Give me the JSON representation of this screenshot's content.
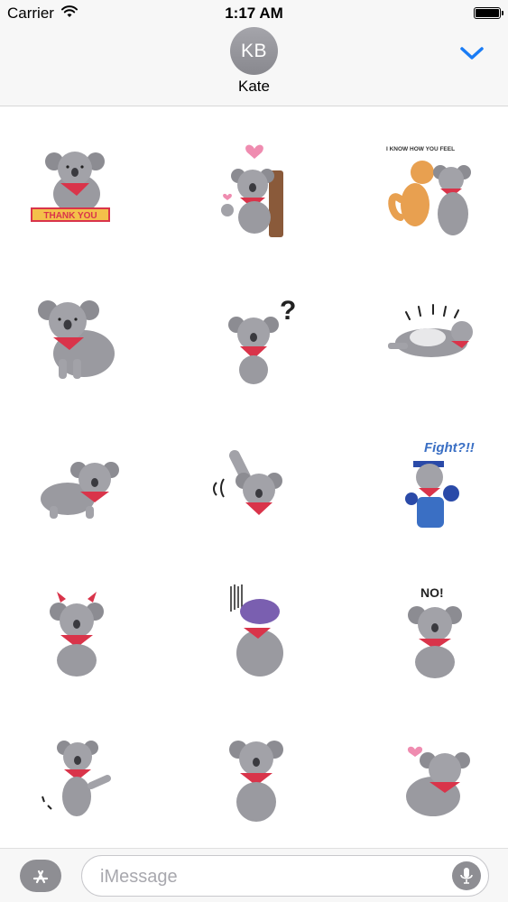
{
  "status_bar": {
    "carrier": "Carrier",
    "time": "1:17 AM",
    "battery_level": 1.0
  },
  "header": {
    "avatar_initials": "KB",
    "contact_name": "Kate",
    "collapse_icon": "chevron-down-icon",
    "accent_color": "#1a7cf5"
  },
  "stickers": [
    {
      "name": "koala-thank-you",
      "caption": "THANK YOU"
    },
    {
      "name": "koala-heart-tree",
      "caption": ""
    },
    {
      "name": "koala-friends",
      "caption": "I KNOW HOW YOU FEEL"
    },
    {
      "name": "koala-sitting",
      "caption": ""
    },
    {
      "name": "koala-question",
      "caption": "?"
    },
    {
      "name": "koala-lying",
      "caption": ""
    },
    {
      "name": "koala-crawling",
      "caption": ""
    },
    {
      "name": "koala-waving",
      "caption": ""
    },
    {
      "name": "koala-fight",
      "caption": "Fight?!!"
    },
    {
      "name": "koala-devil",
      "caption": ""
    },
    {
      "name": "koala-gloomy",
      "caption": ""
    },
    {
      "name": "koala-no",
      "caption": "NO!"
    },
    {
      "name": "koala-dancing",
      "caption": ""
    },
    {
      "name": "koala-hug",
      "caption": ""
    },
    {
      "name": "koala-love",
      "caption": ""
    }
  ],
  "compose": {
    "placeholder": "iMessage",
    "appstore_icon": "app-store-icon",
    "mic_icon": "microphone-icon"
  }
}
